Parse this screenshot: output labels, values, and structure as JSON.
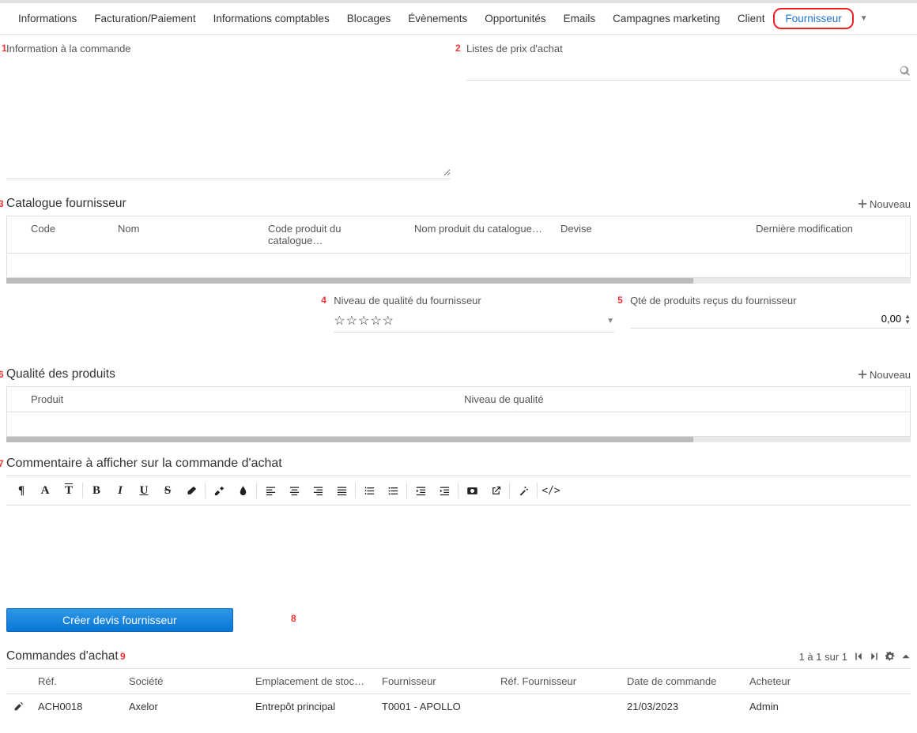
{
  "tabs": [
    "Informations",
    "Facturation/Paiement",
    "Informations comptables",
    "Blocages",
    "Évènements",
    "Opportunités",
    "Emails",
    "Campagnes marketing",
    "Client",
    "Fournisseur"
  ],
  "active_tab_index": 9,
  "info_commande": {
    "label": "Information à la commande",
    "marker": "1",
    "value": ""
  },
  "listes_prix": {
    "label": "Listes de prix d'achat",
    "marker": "2"
  },
  "catalogue": {
    "title": "Catalogue fournisseur",
    "marker": "3",
    "nouveau": "Nouveau",
    "cols": [
      "Code",
      "Nom",
      "Code produit du catalogue…",
      "Nom produit du catalogue…",
      "Devise",
      "Dernière modification"
    ]
  },
  "niveau_qualite": {
    "label": "Niveau de qualité du fournisseur",
    "marker": "4",
    "stars": "☆☆☆☆☆"
  },
  "qte_recus": {
    "label": "Qté de produits reçus du fournisseur",
    "marker": "5",
    "value": "0,00"
  },
  "qualite_produits": {
    "title": "Qualité des produits",
    "marker": "6",
    "nouveau": "Nouveau",
    "cols": [
      "Produit",
      "Niveau de qualité"
    ]
  },
  "commentaire": {
    "title": "Commentaire à afficher sur la commande d'achat",
    "marker": "7"
  },
  "create_button": {
    "label": "Créer devis fournisseur",
    "marker": "8"
  },
  "commandes": {
    "title": "Commandes d'achat",
    "marker": "9",
    "pager_text": "1 à 1 sur 1",
    "cols": [
      "Réf.",
      "Société",
      "Emplacement de stoc…",
      "Fournisseur",
      "Réf. Fournisseur",
      "Date de commande",
      "Acheteur"
    ],
    "rows": [
      {
        "ref": "ACH0018",
        "societe": "Axelor",
        "emplacement": "Entrepôt principal",
        "fournisseur": "T0001 - APOLLO",
        "ref_four": "",
        "date": "21/03/2023",
        "acheteur": "Admin"
      }
    ]
  }
}
